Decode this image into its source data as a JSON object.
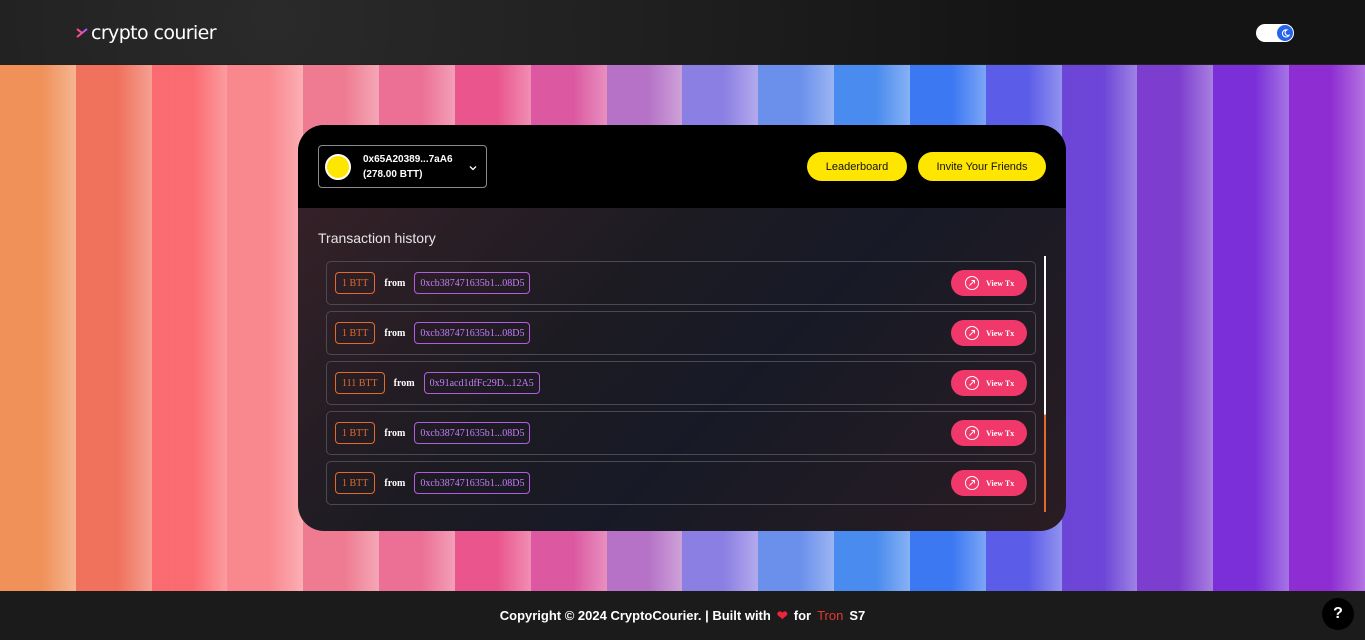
{
  "app": {
    "brand": "crypto courier"
  },
  "header": {
    "theme_toggle": "dark-mode"
  },
  "colors": {
    "accent_yellow": "#ffe600",
    "view_tx_pink": "#f0386b",
    "amount_orange": "#e26a2c",
    "address_purple": "#c77dff",
    "toggle_blue": "#2563eb",
    "stripes": [
      "#f0915a",
      "#f0715c",
      "#fa6b71",
      "#f9878e",
      "#ef7b92",
      "#ec6f95",
      "#e9558c",
      "#dc58a0",
      "#b672c6",
      "#8c7fe3",
      "#6a90ec",
      "#4a8bef",
      "#3b78f2",
      "#5b5ce8",
      "#6d45d7",
      "#7d3ed0",
      "#7a2fd8",
      "#8e2ed2"
    ]
  },
  "wallet": {
    "address": "0x65A20389...7aA6",
    "balance": "(278.00 BTT)"
  },
  "buttons": {
    "leaderboard": "Leaderboard",
    "invite": "Invite Your Friends",
    "view_tx": "View Tx"
  },
  "transactions": {
    "title": "Transaction history",
    "from_label": "from",
    "rows": [
      {
        "amount": "1 BTT",
        "address": "0xcb387471635b1...08D5"
      },
      {
        "amount": "1 BTT",
        "address": "0xcb387471635b1...08D5"
      },
      {
        "amount": "111 BTT",
        "address": "0x91acd1dfFc29D...12A5"
      },
      {
        "amount": "1 BTT",
        "address": "0xcb387471635b1...08D5"
      },
      {
        "amount": "1 BTT",
        "address": "0xcb387471635b1...08D5"
      }
    ]
  },
  "footer": {
    "copyright": "Copyright © 2024 CryptoCourier. | Built with",
    "for": "for",
    "tron": "Tron",
    "suffix": "S7",
    "help": "?"
  }
}
